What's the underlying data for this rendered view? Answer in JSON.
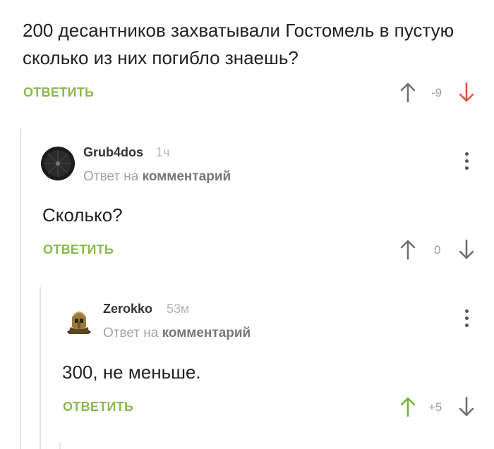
{
  "root_comment": {
    "text": "200 десантников захватывали Гостомель в пустую сколько из них погибло знаешь?",
    "reply_label": "ОТВЕТИТЬ",
    "score": "-9",
    "vote": "down",
    "colors": {
      "down_active": "#e8523f"
    }
  },
  "comments": [
    {
      "username": "Grub4dos",
      "time": "1ч",
      "reply_to_prefix": "Ответ на",
      "reply_to_link": "комментарий",
      "text": "Сколько?",
      "reply_label": "ОТВЕТИТЬ",
      "score": "0",
      "avatar_icon": "dark-umbrella-avatar"
    },
    {
      "username": "Zerokko",
      "time": "53м",
      "reply_to_prefix": "Ответ на",
      "reply_to_link": "комментарий",
      "text": "300, не меньше.",
      "reply_label": "ОТВЕТИТЬ",
      "score": "+5",
      "vote": "up",
      "avatar_icon": "spartan-helmet-avatar",
      "colors": {
        "up_active": "#75b33a"
      }
    }
  ],
  "colors": {
    "accent": "#8ab84f",
    "arrow_neutral": "#707070",
    "thread_line": "#e4e4e4"
  }
}
